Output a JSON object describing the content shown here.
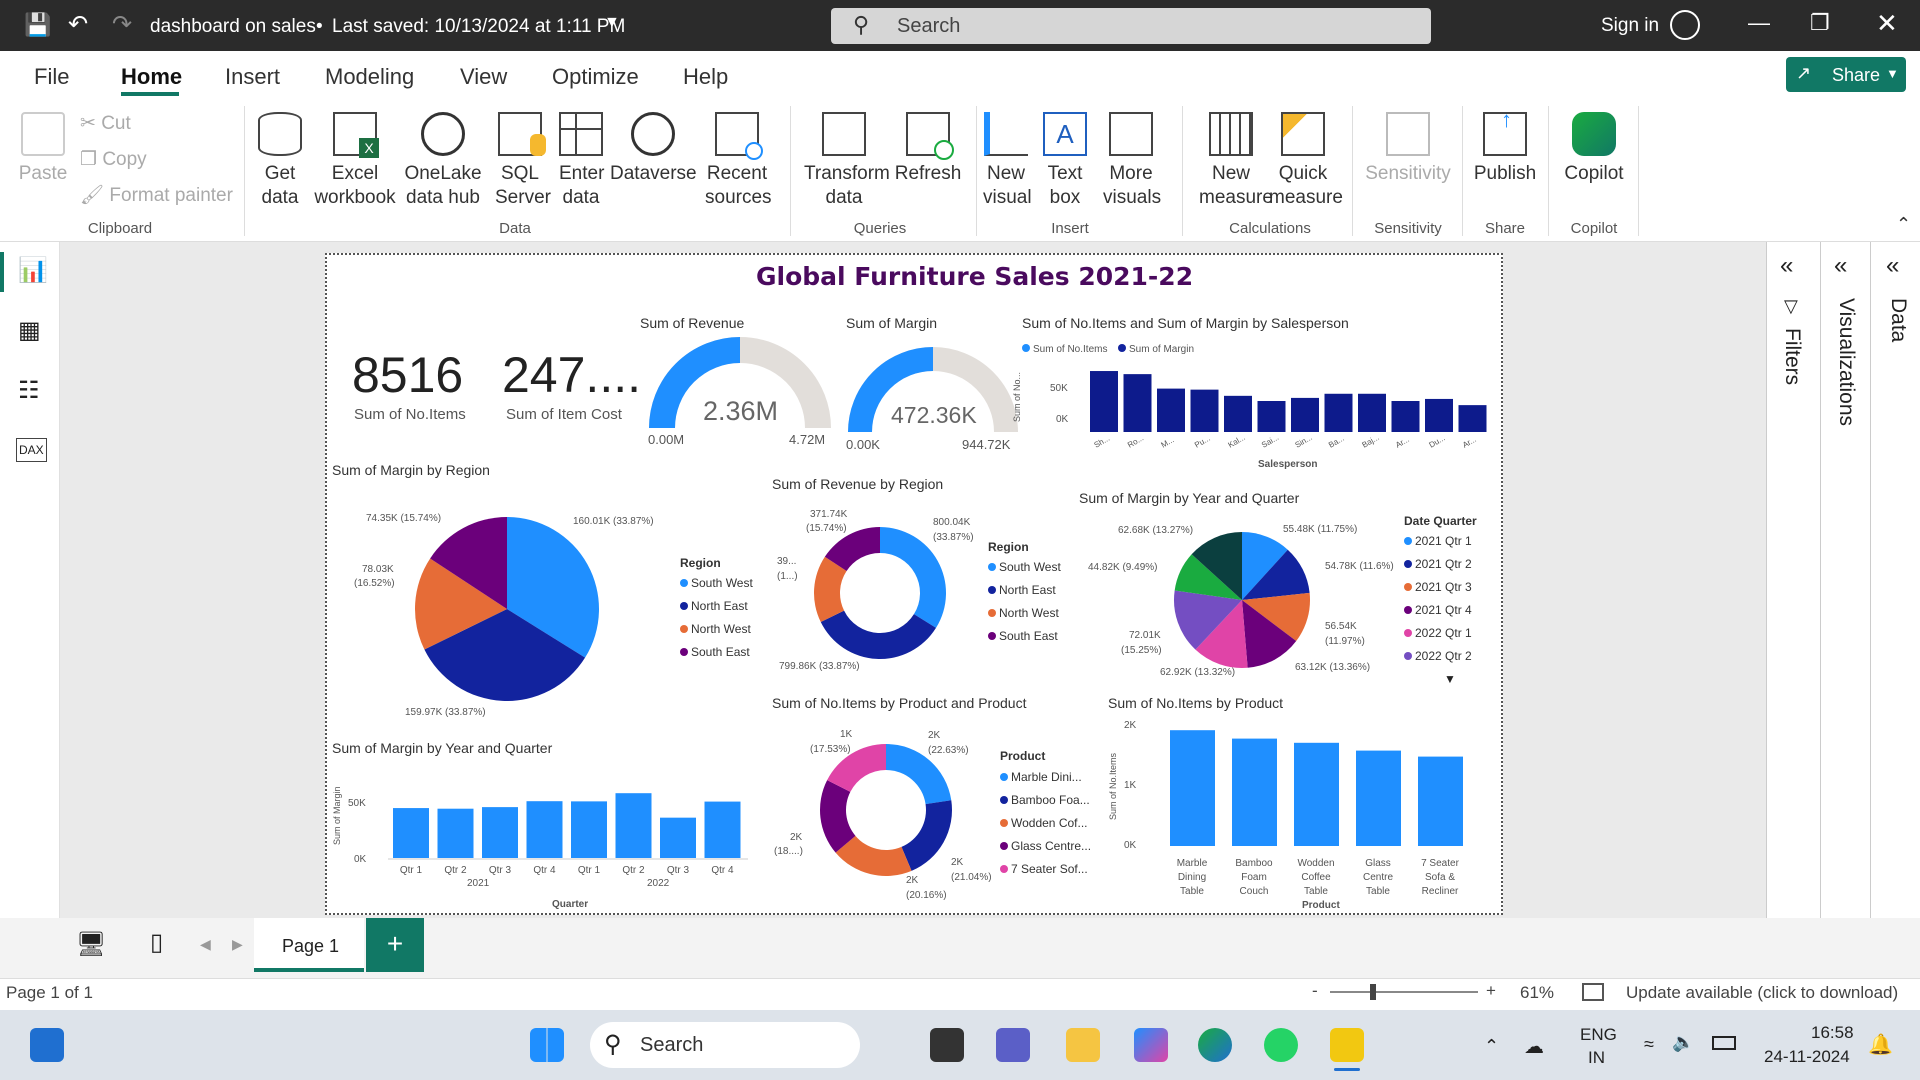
{
  "titlebar": {
    "doc": "dashboard on sales",
    "saved": "Last saved: 10/13/2024 at 1:11 PM",
    "search": "Search",
    "signin": "Sign in"
  },
  "menu": {
    "file": "File",
    "home": "Home",
    "insert": "Insert",
    "modeling": "Modeling",
    "view": "View",
    "optimize": "Optimize",
    "help": "Help",
    "share": "Share"
  },
  "ribbon": {
    "paste": "Paste",
    "cut": "Cut",
    "copy": "Copy",
    "format_painter": "Format painter",
    "clipboard": "Clipboard",
    "get_data": "Get data",
    "excel": "Excel workbook",
    "onelake": "OneLake data hub",
    "sql": "SQL Server",
    "enter_data": "Enter data",
    "dataverse": "Dataverse",
    "recent": "Recent sources",
    "data": "Data",
    "transform": "Transform data",
    "refresh": "Refresh",
    "queries": "Queries",
    "new_visual": "New visual",
    "text_box": "Text box",
    "more_visuals": "More visuals",
    "insert": "Insert",
    "new_measure": "New measure",
    "quick_measure": "Quick measure",
    "calculations": "Calculations",
    "sensitivity": "Sensitivity",
    "sensitivity_grp": "Sensitivity",
    "publish": "Publish",
    "share_grp": "Share",
    "copilot": "Copilot",
    "copilot_grp": "Copilot"
  },
  "report": {
    "title": "Global Furniture Sales 2021-22",
    "card1_value": "8516",
    "card1_label": "Sum of No.Items",
    "card2_value": "247....",
    "card2_label": "Sum of Item Cost",
    "gauge1": {
      "title": "Sum of Revenue",
      "value": "2.36M",
      "min": "0.00M",
      "max": "4.72M",
      "fraction": 0.5
    },
    "gauge2": {
      "title": "Sum of Margin",
      "value": "472.36K",
      "min": "0.00K",
      "max": "944.72K",
      "fraction": 0.5
    },
    "salesperson": {
      "title": "Sum of No.Items and Sum of Margin by Salesperson",
      "legend1": "Sum of No.Items",
      "legend2": "Sum of Margin",
      "ylabel": "Sum of No...",
      "xlabel": "Salesperson",
      "y50": "50K",
      "y0": "0K"
    },
    "region_pie": {
      "title": "Sum of Margin by Region",
      "legend_title": "Region",
      "labels": [
        "74.35K (15.74%)",
        "160.01K (33.87%)",
        "78.03K",
        "(16.52%)",
        "159.97K (33.87%)"
      ]
    },
    "rev_region": {
      "title": "Sum of Revenue by Region",
      "legend_title": "Region",
      "labels": [
        "371.74K",
        "(15.74%)",
        "800.04K",
        "(33.87%)",
        "39...",
        "(1...)",
        "799.86K (33.87%)"
      ]
    },
    "year_quarter_pie": {
      "title": "Sum of Margin by Year and Quarter",
      "legend_title": "Date Quarter",
      "labels": [
        "62.68K (13.27%)",
        "55.48K (11.75%)",
        "44.82K (9.49%)",
        "54.78K (11.6%)",
        "72.01K",
        "(15.25%)",
        "56.54K",
        "(11.97%)",
        "62.92K (13.32%)",
        "63.12K (13.36%)"
      ],
      "legend": [
        "2021 Qtr 1",
        "2021 Qtr 2",
        "2021 Qtr 3",
        "2021 Qtr 4",
        "2022 Qtr 1",
        "2022 Qtr 2"
      ]
    },
    "margin_yq_bar": {
      "title": "Sum of Margin by Year and Quarter",
      "ylabel": "Sum of Margin",
      "xlabel": "Quarter",
      "y50": "50K",
      "y0": "0K",
      "year1": "2021",
      "year2": "2022"
    },
    "product_donut": {
      "title": "Sum of No.Items by Product and Product",
      "legend_title": "Product",
      "labels": [
        "1K",
        "(17.53%)",
        "2K",
        "(22.63%)",
        "2K",
        "(18....)",
        "2K",
        "(21.04%)",
        "2K",
        "(20.16%)"
      ],
      "legend": [
        "Marble Dini...",
        "Bamboo Foa...",
        "Wodden Cof...",
        "Glass Centre...",
        "7 Seater Sof..."
      ]
    },
    "product_bar": {
      "title": "Sum of No.Items by Product",
      "ylabel": "Sum of No.Items",
      "xlabel": "Product",
      "y2": "2K",
      "y1": "1K",
      "y0": "0K",
      "cats": [
        "Marble Dining Table",
        "Bamboo Foam Couch",
        "Wodden Coffee Table",
        "Glass Centre Table",
        "7 Seater Sofa & Recliner"
      ]
    }
  },
  "panes": {
    "filters": "Filters",
    "visualizations": "Visualizations",
    "data": "Data"
  },
  "pagebar": {
    "page1": "Page 1",
    "add": "+"
  },
  "status": {
    "page": "Page 1 of 1",
    "zoom": "61%",
    "update": "Update available (click to download)"
  },
  "taskbar": {
    "search": "Search",
    "lang1": "ENG",
    "lang2": "IN",
    "time": "16:58",
    "date": "24-11-2024"
  },
  "chart_data": [
    {
      "type": "bar",
      "title": "Sum of No.Items and Sum of Margin by Salesperson",
      "categories": [
        "Sh...",
        "Ro...",
        "M...",
        "Pu...",
        "Kal...",
        "Sai...",
        "Sin...",
        "Ba...",
        "Baj...",
        "Ar...",
        "Du...",
        "Ar..."
      ],
      "series": [
        {
          "name": "Sum of No.Items",
          "values": [
            0,
            0,
            0,
            0,
            0,
            0,
            0,
            0,
            0,
            0,
            0,
            0
          ]
        },
        {
          "name": "Sum of Margin",
          "values": [
            59,
            56,
            42,
            41,
            35,
            30,
            33,
            37,
            37,
            30,
            32,
            26
          ]
        }
      ],
      "ylim": [
        0,
        60
      ],
      "color": "#0d1b8c"
    },
    {
      "type": "pie",
      "title": "Sum of Margin by Region",
      "categories": [
        "South West",
        "North East",
        "North West",
        "South East"
      ],
      "values": [
        160.01,
        159.97,
        78.03,
        74.35
      ],
      "colors": [
        "#1f8fff",
        "#12239e",
        "#e66c37",
        "#6b007b"
      ]
    },
    {
      "type": "pie",
      "title": "Sum of Revenue by Region",
      "categories": [
        "South West",
        "North East",
        "North West",
        "South East"
      ],
      "values": [
        800.04,
        799.86,
        390,
        371.74
      ],
      "colors": [
        "#1f8fff",
        "#12239e",
        "#e66c37",
        "#6b007b"
      ]
    },
    {
      "type": "pie",
      "title": "Sum of Margin by Year and Quarter",
      "categories": [
        "2021 Qtr 1",
        "2021 Qtr 2",
        "2021 Qtr 3",
        "2021 Qtr 4",
        "2022 Qtr 1",
        "2022 Qtr 2",
        "2022 Qtr 3",
        "2022 Qtr 4"
      ],
      "values": [
        55.48,
        54.78,
        56.54,
        63.12,
        62.92,
        72.01,
        44.82,
        62.68
      ],
      "colors": [
        "#1f8fff",
        "#12239e",
        "#e66c37",
        "#6b007b",
        "#e044a7",
        "#744ec2",
        "#1aab40",
        "#0b3f3f"
      ]
    },
    {
      "type": "bar",
      "title": "Sum of Margin by Year and Quarter",
      "categories": [
        "Qtr 1",
        "Qtr 2",
        "Qtr 3",
        "Qtr 4",
        "Qtr 1",
        "Qtr 2",
        "Qtr 3",
        "Qtr 4"
      ],
      "values": [
        55.48,
        54.78,
        56.54,
        63.12,
        62.92,
        72.01,
        44.82,
        62.68
      ],
      "ylim": [
        0,
        80
      ],
      "color": "#1f8fff"
    },
    {
      "type": "pie",
      "title": "Sum of No.Items by Product and Product",
      "categories": [
        "Marble Dini...",
        "Bamboo Foa...",
        "Wodden Cof...",
        "Glass Centre...",
        "7 Seater Sof..."
      ],
      "values": [
        22.63,
        21.04,
        20.16,
        18.64,
        17.53
      ],
      "colors": [
        "#1f8fff",
        "#12239e",
        "#e66c37",
        "#6b007b",
        "#e044a7"
      ]
    },
    {
      "type": "bar",
      "title": "Sum of No.Items by Product",
      "categories": [
        "Marble Dining Table",
        "Bamboo Foam Couch",
        "Wodden Coffee Table",
        "Glass Centre Table",
        "7 Seater Sofa & Recliner"
      ],
      "values": [
        1930,
        1790,
        1720,
        1590,
        1490
      ],
      "ylim": [
        0,
        2000
      ],
      "color": "#1f8fff"
    }
  ]
}
